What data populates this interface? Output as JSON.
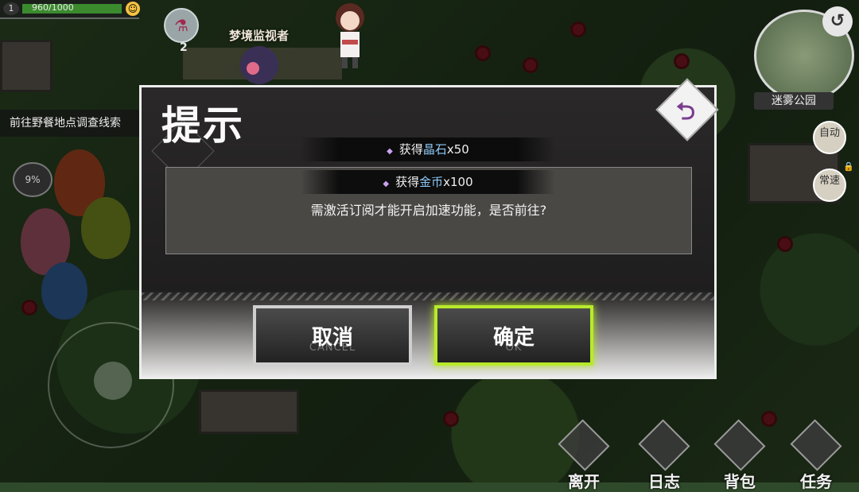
{
  "hud": {
    "level": "1",
    "exp_text": "960/1000",
    "potion_count": "2",
    "npc_name": "梦境监视者",
    "quest_text": "前往野餐地点调查线索",
    "speed_percent": "9%",
    "minimap_label": "迷雾公园",
    "auto_label": "自动",
    "speed_label": "常速"
  },
  "dialog": {
    "title": "提示",
    "rewards": [
      {
        "prefix": "获得",
        "item": "晶石",
        "amount": "x50"
      },
      {
        "prefix": "获得",
        "item": "金币",
        "amount": "x100"
      }
    ],
    "message": "需激活订阅才能开启加速功能，是否前往?",
    "cancel_label": "取消",
    "cancel_sub": "CANCEL",
    "ok_label": "确定",
    "ok_sub": "OK"
  },
  "bottom_menu": [
    {
      "label": "离开"
    },
    {
      "label": "日志"
    },
    {
      "label": "背包"
    },
    {
      "label": "任务"
    }
  ],
  "colors": {
    "confirm_glow": "#b8ea2a",
    "reward_highlight": "#8ec8f6",
    "dialog_close_glyph": "#7a3d8e"
  }
}
